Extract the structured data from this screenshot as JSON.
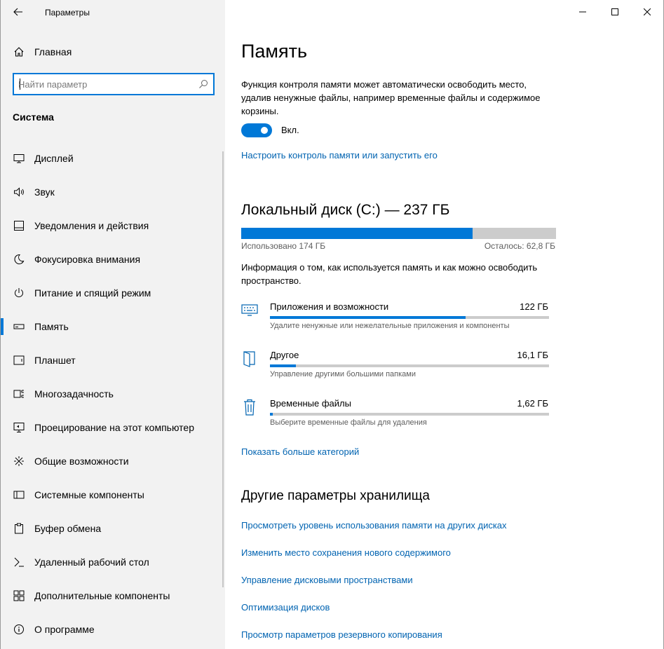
{
  "window": {
    "app_title": "Параметры",
    "controls": [
      "minimize-icon",
      "maximize-icon",
      "close-icon"
    ]
  },
  "sidebar": {
    "home_label": "Главная",
    "search": {
      "placeholder": "Найти параметр",
      "value": ""
    },
    "section_title": "Система",
    "items": [
      {
        "label": "Дисплей",
        "icon": "display-icon",
        "selected": false
      },
      {
        "label": "Звук",
        "icon": "sound-icon",
        "selected": false
      },
      {
        "label": "Уведомления и действия",
        "icon": "notifications-icon",
        "selected": false
      },
      {
        "label": "Фокусировка внимания",
        "icon": "focus-assist-icon",
        "selected": false
      },
      {
        "label": "Питание и спящий режим",
        "icon": "power-icon",
        "selected": false
      },
      {
        "label": "Память",
        "icon": "storage-icon",
        "selected": true
      },
      {
        "label": "Планшет",
        "icon": "tablet-icon",
        "selected": false
      },
      {
        "label": "Многозадачность",
        "icon": "multitasking-icon",
        "selected": false
      },
      {
        "label": "Проецирование на этот компьютер",
        "icon": "projecting-icon",
        "selected": false
      },
      {
        "label": "Общие возможности",
        "icon": "shared-experiences-icon",
        "selected": false
      },
      {
        "label": "Системные компоненты",
        "icon": "system-components-icon",
        "selected": false
      },
      {
        "label": "Буфер обмена",
        "icon": "clipboard-icon",
        "selected": false
      },
      {
        "label": "Удаленный рабочий стол",
        "icon": "remote-desktop-icon",
        "selected": false
      },
      {
        "label": "Дополнительные компоненты",
        "icon": "optional-features-icon",
        "selected": false
      },
      {
        "label": "О программе",
        "icon": "info-icon",
        "selected": false
      }
    ]
  },
  "main": {
    "title": "Память",
    "description": "Функция контроля памяти может автоматически освободить место, удалив ненужные файлы, например временные файлы и содержимое корзины.",
    "toggle": {
      "state": "on",
      "label": "Вкл."
    },
    "configure_link": "Настроить контроль памяти или запустить его",
    "disk": {
      "title": "Локальный диск (C:) — 237 ГБ",
      "used_label": "Использовано 174 ГБ",
      "free_label": "Осталось: 62,8 ГБ",
      "used_fraction": 0.735
    },
    "usage_info": "Информация о том, как используется память и как можно освободить пространство.",
    "categories": [
      {
        "name": "Приложения и возможности",
        "size": "122 ГБ",
        "description": "Удалите ненужные или нежелательные приложения и компоненты",
        "fraction": 0.7,
        "icon": "apps-keyboard-icon"
      },
      {
        "name": "Другое",
        "size": "16,1 ГБ",
        "description": "Управление другими большими папками",
        "fraction": 0.093,
        "icon": "other-folder-icon"
      },
      {
        "name": "Временные файлы",
        "size": "1,62 ГБ",
        "description": "Выберите временные файлы для удаления",
        "fraction": 0.01,
        "icon": "trash-icon"
      }
    ],
    "show_more_link": "Показать больше категорий",
    "other_settings_title": "Другие параметры хранилища",
    "other_links": [
      "Просмотреть уровень использования памяти на других дисках",
      "Изменить место сохранения нового содержимого",
      "Управление дисковыми пространствами",
      "Оптимизация дисков",
      "Просмотр параметров резервного копирования"
    ]
  },
  "colors": {
    "accent": "#0078d7",
    "link": "#0063b1",
    "sidebar_bg": "#f2f2f2",
    "bar_track": "#cccccc"
  }
}
